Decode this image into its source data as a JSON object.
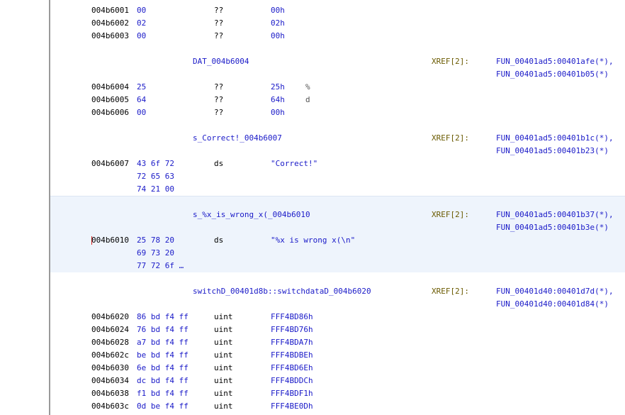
{
  "rows": [
    {
      "addr": "004b6001",
      "bytes": "00",
      "mnem": "??",
      "oper": "00h",
      "chr": ""
    },
    {
      "addr": "004b6002",
      "bytes": "02",
      "mnem": "??",
      "oper": "02h",
      "chr": ""
    },
    {
      "addr": "004b6003",
      "bytes": "00",
      "mnem": "??",
      "oper": "00h",
      "chr": ""
    },
    {
      "label": "DAT_004b6004",
      "xref": "XREF[2]:",
      "xref_refs": [
        "FUN_00401ad5:00401afe(*),",
        "FUN_00401ad5:00401b05(*)"
      ]
    },
    {
      "addr": "004b6004",
      "bytes": "25",
      "mnem": "??",
      "oper": "25h",
      "chr": "%"
    },
    {
      "addr": "004b6005",
      "bytes": "64",
      "mnem": "??",
      "oper": "64h",
      "chr": "d"
    },
    {
      "addr": "004b6006",
      "bytes": "00",
      "mnem": "??",
      "oper": "00h",
      "chr": ""
    },
    {
      "label": "s_Correct!_004b6007",
      "xref": "XREF[2]:",
      "xref_refs": [
        "FUN_00401ad5:00401b1c(*),",
        "FUN_00401ad5:00401b23(*)"
      ]
    },
    {
      "addr": "004b6007",
      "bytes": "43 6f 72",
      "mnem": "ds",
      "oper": "\"Correct!\"",
      "chr": ""
    },
    {
      "addr": "",
      "bytes": "72 65 63",
      "mnem": "",
      "oper": "",
      "chr": ""
    },
    {
      "addr": "",
      "bytes": "74 21 00",
      "mnem": "",
      "oper": "",
      "chr": ""
    },
    {
      "label": "s_%x_is_wrong_x(_004b6010",
      "xref": "XREF[2]:",
      "xref_refs": [
        "FUN_00401ad5:00401b37(*),",
        "FUN_00401ad5:00401b3e(*)"
      ]
    },
    {
      "addr": "004b6010",
      "bytes": "25 78 20",
      "mnem": "ds",
      "oper": "\"%x is wrong x(\\n\"",
      "chr": ""
    },
    {
      "addr": "",
      "bytes": "69 73 20",
      "mnem": "",
      "oper": "",
      "chr": ""
    },
    {
      "addr": "",
      "bytes": "77 72 6f …",
      "mnem": "",
      "oper": "",
      "chr": ""
    },
    {
      "label": "switchD_00401d8b::switchdataD_004b6020",
      "xref": "XREF[2]:",
      "xref_refs": [
        "FUN_00401d40:00401d7d(*),",
        "FUN_00401d40:00401d84(*)"
      ]
    },
    {
      "addr": "004b6020",
      "bytes": "86 bd f4 ff",
      "mnem": "uint",
      "oper": "FFF4BD86h",
      "chr": ""
    },
    {
      "addr": "004b6024",
      "bytes": "76 bd f4 ff",
      "mnem": "uint",
      "oper": "FFF4BD76h",
      "chr": ""
    },
    {
      "addr": "004b6028",
      "bytes": "a7 bd f4 ff",
      "mnem": "uint",
      "oper": "FFF4BDA7h",
      "chr": ""
    },
    {
      "addr": "004b602c",
      "bytes": "be bd f4 ff",
      "mnem": "uint",
      "oper": "FFF4BDBEh",
      "chr": ""
    },
    {
      "addr": "004b6030",
      "bytes": "6e bd f4 ff",
      "mnem": "uint",
      "oper": "FFF4BD6Eh",
      "chr": ""
    },
    {
      "addr": "004b6034",
      "bytes": "dc bd f4 ff",
      "mnem": "uint",
      "oper": "FFF4BDDCh",
      "chr": ""
    },
    {
      "addr": "004b6038",
      "bytes": "f1 bd f4 ff",
      "mnem": "uint",
      "oper": "FFF4BDF1h",
      "chr": ""
    },
    {
      "addr": "004b603c",
      "bytes": "0d be f4 ff",
      "mnem": "uint",
      "oper": "FFF4BE0Dh",
      "chr": ""
    }
  ],
  "colors": {
    "background": "#ffffff",
    "address": "#000000",
    "bytes": "#1a1ac8",
    "label": "#1a1ac8",
    "xref_keyword": "#6a5a00",
    "selection": "#eef4fc",
    "cursor": "#d02020"
  }
}
